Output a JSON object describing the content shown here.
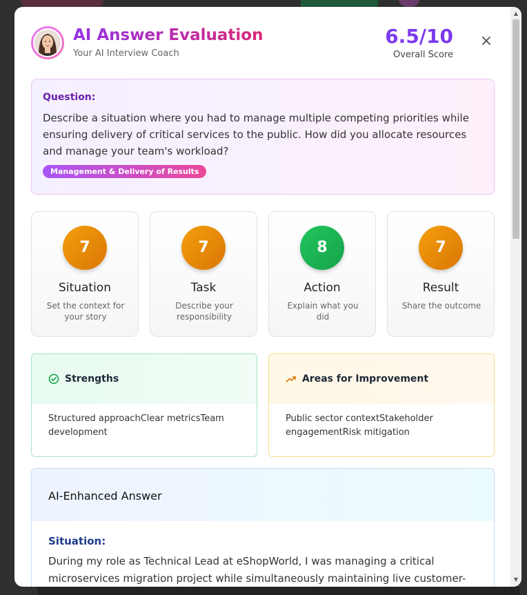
{
  "header": {
    "title": "AI Answer Evaluation",
    "subtitle": "Your AI Interview Coach",
    "score": "6.5/10",
    "score_label": "Overall Score",
    "close_symbol": "×"
  },
  "question": {
    "label": "Question:",
    "text": "Describe a situation where you had to manage multiple competing priorities while ensuring delivery of critical services to the public. How did you allocate resources and manage your team's workload?",
    "tag": "Management & Delivery of Results"
  },
  "star": [
    {
      "score": "7",
      "title": "Situation",
      "desc": "Set the context for your story",
      "color": "#f59e0b"
    },
    {
      "score": "7",
      "title": "Task",
      "desc": "Describe your responsibility",
      "color": "#f59e0b"
    },
    {
      "score": "8",
      "title": "Action",
      "desc": "Explain what you did",
      "color": "#22c55e"
    },
    {
      "score": "7",
      "title": "Result",
      "desc": "Share the outcome",
      "color": "#f59e0b"
    }
  ],
  "strengths": {
    "title": "Strengths",
    "icon": "check-circle-icon",
    "text": "Structured approachClear metricsTeam development"
  },
  "improvements": {
    "title": "Areas for Improvement",
    "icon": "trending-up-icon",
    "text": "Public sector contextStakeholder engagementRisk mitigation"
  },
  "enhanced": {
    "title": "AI-Enhanced Answer",
    "section_label": "Situation:",
    "text": "During my role as Technical Lead at eShopWorld, I was managing a critical microservices migration project while simultaneously maintaining live customer-facing systems that"
  },
  "colors": {
    "accent_purple": "#7c3aed",
    "accent_pink": "#db2777",
    "strength_green": "#16a34a",
    "improve_orange": "#d97706"
  }
}
